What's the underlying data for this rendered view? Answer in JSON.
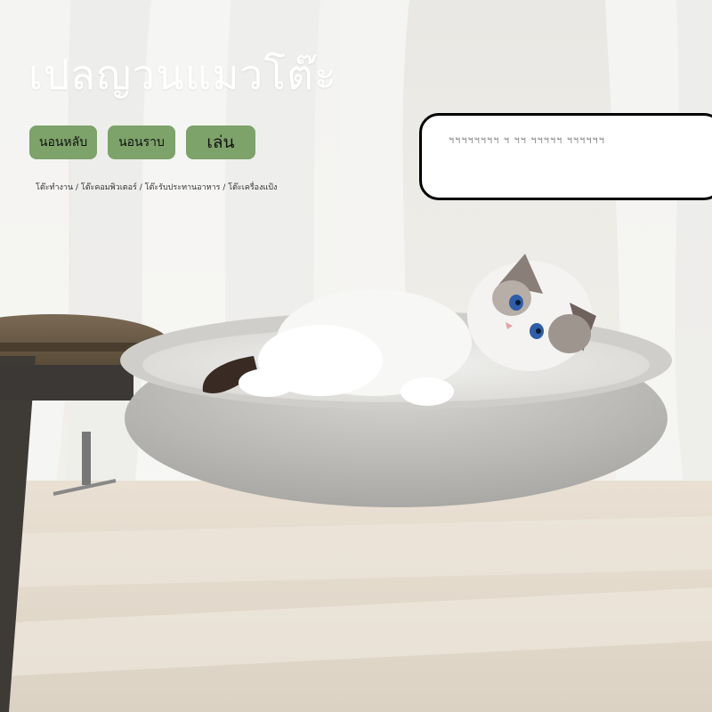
{
  "title": "เปลญวนแมวโต๊ะ",
  "tags": [
    "นอนหลับ",
    "นอนราบ",
    "เล่น"
  ],
  "subtitle": "โต๊ะทำงาน / โต๊ะคอมพิวเตอร์ / โต๊ะรับประทานอาหาร / โต๊ะเครื่องแป้ง",
  "panel_text": "ฯฯฯฯฯฯฯฯ ฯ ฯฯ ฯฯฯฯฯ ฯฯฯฯฯฯ",
  "colors": {
    "tag_green": "#7da26a",
    "panel_border": "#000000",
    "title_color": "#ffffff"
  },
  "image": {
    "subject": "cat-in-plush-hammock-on-table"
  }
}
